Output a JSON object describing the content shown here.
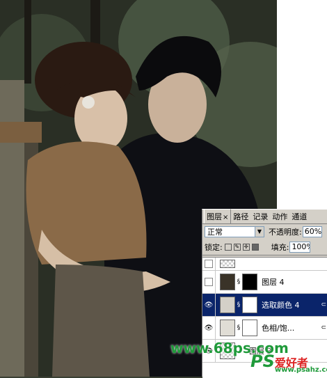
{
  "watermark": {
    "left": "www.68ps.com",
    "right_logo": "PS",
    "right_chars": "爱好者",
    "right_url": "www.psahz.com"
  },
  "panel": {
    "tabs": [
      {
        "label": "图层",
        "close": "×",
        "active": true
      },
      {
        "label": "路径"
      },
      {
        "label": "记录"
      },
      {
        "label": "动作"
      },
      {
        "label": "通道"
      }
    ],
    "blend_mode": "正常",
    "opacity_label": "不透明度:",
    "opacity_value": "60%",
    "lock_label": "锁定:",
    "fill_label": "填充:",
    "fill_value": "100%",
    "layers": [
      {
        "name": "",
        "visible": false
      },
      {
        "name": "图层 4",
        "visible": false
      },
      {
        "name": "选取颜色 4",
        "visible": true,
        "selected": true
      },
      {
        "name": "色相/饱...",
        "visible": true
      },
      {
        "name": "图层 3",
        "visible": true
      }
    ]
  },
  "colors": {
    "selected": "#0a246a",
    "panel_bg": "#d4d0c8",
    "watermark_green": "#1f9a3a"
  }
}
